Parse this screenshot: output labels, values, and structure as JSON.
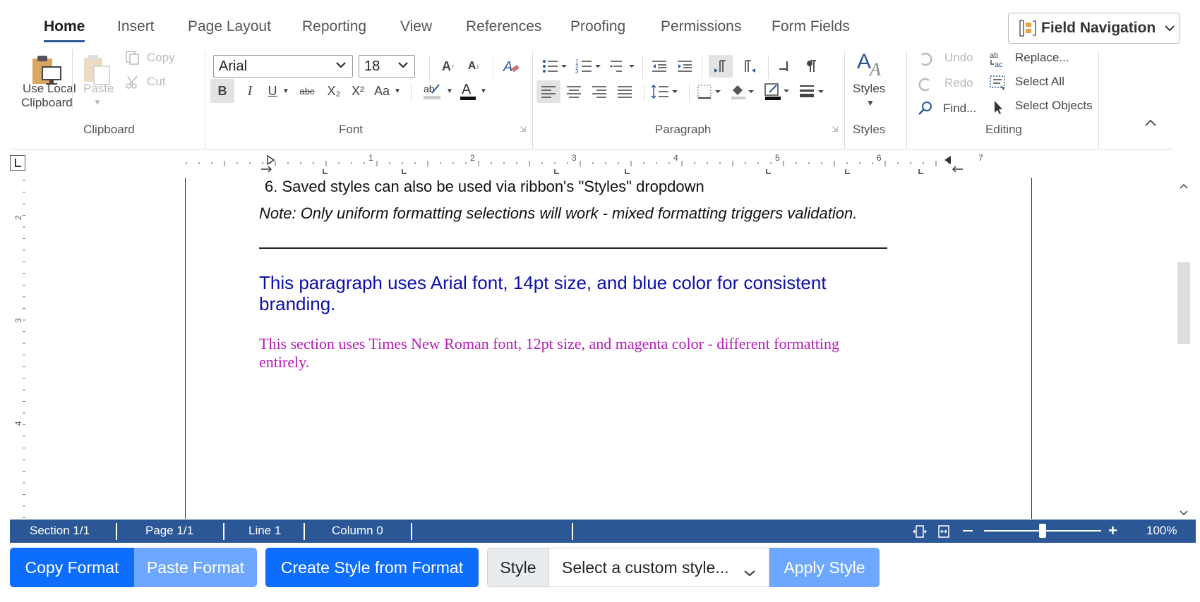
{
  "tabs": [
    "Home",
    "Insert",
    "Page Layout",
    "Reporting",
    "View",
    "References",
    "Proofing",
    "Permissions",
    "Form Fields"
  ],
  "field_navigation": "Field Navigation",
  "clipboard": {
    "use_local": "Use Local",
    "use_local2": "Clipboard",
    "paste": "Paste",
    "copy": "Copy",
    "cut": "Cut",
    "group": "Clipboard"
  },
  "font": {
    "family": "Arial",
    "size": "18",
    "group": "Font",
    "bold": "B",
    "italic": "I",
    "underline": "U",
    "strike": "abc",
    "subscript": "X₂",
    "superscript": "X²",
    "case": "Aa"
  },
  "paragraph": {
    "group": "Paragraph"
  },
  "styles": {
    "label": "Styles",
    "group": "Styles"
  },
  "editing": {
    "undo": "Undo",
    "redo": "Redo",
    "find": "Find...",
    "replace": "Replace...",
    "select_all": "Select All",
    "select_objects": "Select Objects",
    "group": "Editing"
  },
  "ruler": {
    "numbers": [
      "1",
      "2",
      "3",
      "4",
      "5",
      "6",
      "7"
    ],
    "vnumbers": [
      "2",
      "3",
      "4"
    ]
  },
  "document": {
    "line1": "6. Saved styles can also be used via ribbon's \"Styles\" dropdown",
    "note": "Note: Only uniform formatting selections will work - mixed formatting triggers validation.",
    "blue_line1": "This paragraph uses Arial font, 14pt size, and blue color for consistent",
    "blue_line2": "branding.",
    "magenta_line1": "This section uses Times New Roman font, 12pt size, and magenta color - different formatting",
    "magenta_line2": "entirely."
  },
  "status": {
    "section": "Section 1/1",
    "page": "Page 1/1",
    "line": "Line 1",
    "column": "Column 0",
    "zoom": "100%",
    "zoom_level": 0.5
  },
  "bottom": {
    "copy_format": "Copy Format",
    "paste_format": "Paste Format",
    "create_style": "Create Style from Format",
    "style_label": "Style",
    "style_placeholder": "Select a custom style...",
    "apply_style": "Apply Style"
  },
  "colors": {
    "accent": "#2b5797",
    "blue_text": "#0d10a8",
    "magenta_text": "#b81cb8",
    "button_blue": "#0d6efd",
    "button_light": "#6ea8fe"
  }
}
